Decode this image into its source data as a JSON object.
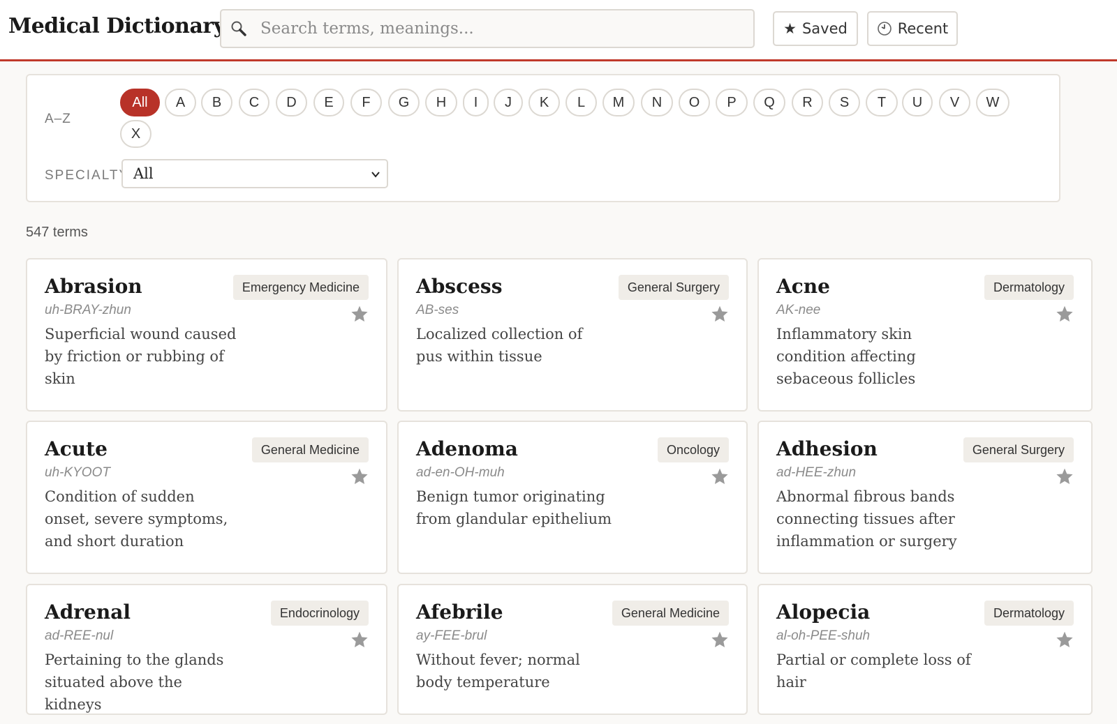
{
  "header": {
    "title": "Medical Dictionary",
    "search_placeholder": "Search terms, meanings...",
    "saved_label": "Saved",
    "recent_label": "Recent"
  },
  "filters": {
    "az_label": "A–Z",
    "letters": [
      "All",
      "A",
      "B",
      "C",
      "D",
      "E",
      "F",
      "G",
      "H",
      "I",
      "J",
      "K",
      "L",
      "M",
      "N",
      "O",
      "P",
      "Q",
      "R",
      "S",
      "T",
      "U",
      "V",
      "W",
      "X"
    ],
    "active_letter": "All",
    "specialty_label": "SPECIALTY",
    "specialty_value": "All"
  },
  "results": {
    "count_text": "547 terms"
  },
  "terms": [
    {
      "term": "Abrasion",
      "pron": "uh-BRAY-zhun",
      "specialty": "Emergency Medicine",
      "def": "Superficial wound caused by friction or rubbing of skin"
    },
    {
      "term": "Abscess",
      "pron": "AB-ses",
      "specialty": "General Surgery",
      "def": "Localized collection of pus within tissue"
    },
    {
      "term": "Acne",
      "pron": "AK-nee",
      "specialty": "Dermatology",
      "def": "Inflammatory skin condition affecting sebaceous follicles"
    },
    {
      "term": "Acute",
      "pron": "uh-KYOOT",
      "specialty": "General Medicine",
      "def": "Condition of sudden onset, severe symptoms, and short duration"
    },
    {
      "term": "Adenoma",
      "pron": "ad-en-OH-muh",
      "specialty": "Oncology",
      "def": "Benign tumor originating from glandular epithelium"
    },
    {
      "term": "Adhesion",
      "pron": "ad-HEE-zhun",
      "specialty": "General Surgery",
      "def": "Abnormal fibrous bands connecting tissues after inflammation or surgery"
    },
    {
      "term": "Adrenal",
      "pron": "ad-REE-nul",
      "specialty": "Endocrinology",
      "def": "Pertaining to the glands situated above the kidneys"
    },
    {
      "term": "Afebrile",
      "pron": "ay-FEE-brul",
      "specialty": "General Medicine",
      "def": "Without fever; normal body temperature"
    },
    {
      "term": "Alopecia",
      "pron": "al-oh-PEE-shuh",
      "specialty": "Dermatology",
      "def": "Partial or complete loss of hair"
    }
  ]
}
